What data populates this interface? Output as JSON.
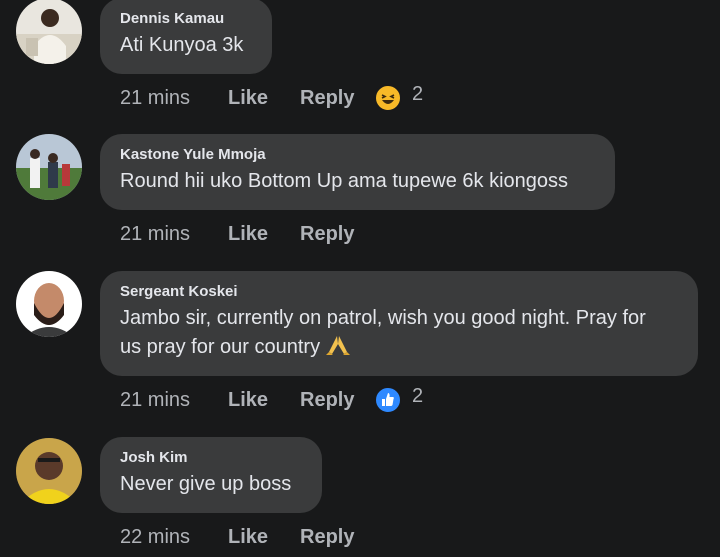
{
  "comments": [
    {
      "author": "Dennis Kamau",
      "text": "Ati Kunyoa 3k",
      "time": "21 mins",
      "like_label": "Like",
      "reply_label": "Reply",
      "reaction_icon": "haha-emoji-icon",
      "reaction_count": "2"
    },
    {
      "author": "Kastone Yule Mmoja",
      "text": "Round hii uko Bottom Up ama tupewe 6k kiongoss",
      "time": "21 mins",
      "like_label": "Like",
      "reply_label": "Reply"
    },
    {
      "author": "Sergeant Koskei",
      "text_line1": "Jambo sir, currently on patrol, wish you good night. Pray for",
      "text_line2": "us pray for our country",
      "text_emoji": "folded-hands-icon",
      "time": "21 mins",
      "like_label": "Like",
      "reply_label": "Reply",
      "reaction_icon": "thumbs-up-icon",
      "reaction_count": "2"
    },
    {
      "author": "Josh Kim",
      "text": "Never give up boss",
      "time": "22 mins",
      "like_label": "Like",
      "reply_label": "Reply"
    }
  ],
  "colors": {
    "background": "#18191a",
    "bubble": "#3a3b3c",
    "text": "#e4e6eb",
    "muted": "#b0b3b8",
    "like_blue": "#2e89ff",
    "haha_yellow": "#f7b928"
  }
}
